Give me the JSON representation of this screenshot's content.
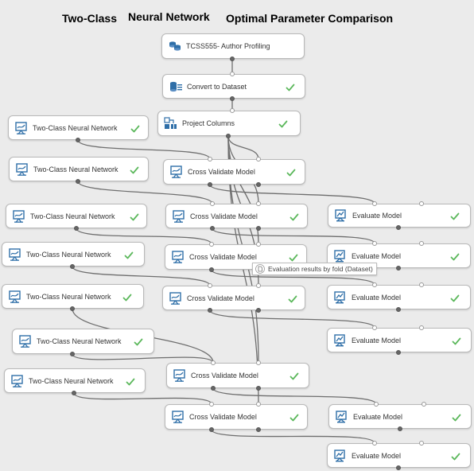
{
  "title": {
    "part1": "Two-Class",
    "part2": "Neural Network",
    "part3": "Optimal Parameter Comparison"
  },
  "colors": {
    "canvas": "#ebebeb",
    "node_bg": "#ffffff",
    "node_border": "#b9b9b9",
    "check": "#5cb85c",
    "icon": "#2f6fa8",
    "wire": "#6e6e6e"
  },
  "modules": [
    {
      "label": "TCSS555- Author Profiling",
      "icon": "dataset-icon",
      "check": false
    },
    {
      "label": "Convert to Dataset",
      "icon": "convert-icon",
      "check": true
    },
    {
      "label": "Project Columns",
      "icon": "project-columns-icon",
      "check": true
    },
    {
      "label": "Two-Class Neural Network",
      "icon": "model-icon",
      "check": true
    },
    {
      "label": "Two-Class Neural Network",
      "icon": "model-icon",
      "check": true
    },
    {
      "label": "Two-Class Neural Network",
      "icon": "model-icon",
      "check": true
    },
    {
      "label": "Two-Class Neural Network",
      "icon": "model-icon",
      "check": true
    },
    {
      "label": "Two-Class Neural Network",
      "icon": "model-icon",
      "check": true
    },
    {
      "label": "Two-Class Neural Network",
      "icon": "model-icon",
      "check": true
    },
    {
      "label": "Two-Class Neural Network",
      "icon": "model-icon",
      "check": true
    },
    {
      "label": "Cross Validate Model",
      "icon": "cross-validate-icon",
      "check": true
    },
    {
      "label": "Cross Validate Model",
      "icon": "cross-validate-icon",
      "check": true
    },
    {
      "label": "Cross Validate Model",
      "icon": "cross-validate-icon",
      "check": true
    },
    {
      "label": "Cross Validate Model",
      "icon": "cross-validate-icon",
      "check": true
    },
    {
      "label": "Cross Validate Model",
      "icon": "cross-validate-icon",
      "check": true
    },
    {
      "label": "Cross Validate Model",
      "icon": "cross-validate-icon",
      "check": true
    },
    {
      "label": "Evaluate Model",
      "icon": "evaluate-icon",
      "check": true
    },
    {
      "label": "Evaluate Model",
      "icon": "evaluate-icon",
      "check": true
    },
    {
      "label": "Evaluate Model",
      "icon": "evaluate-icon",
      "check": true
    },
    {
      "label": "Evaluate Model",
      "icon": "evaluate-icon",
      "check": true
    },
    {
      "label": "Evaluate Model",
      "icon": "evaluate-icon",
      "check": true
    },
    {
      "label": "Evaluate Model",
      "icon": "evaluate-icon",
      "check": true
    }
  ],
  "tooltip": {
    "label": "Evaluation results by fold (Dataset)",
    "icon": "document-icon"
  }
}
